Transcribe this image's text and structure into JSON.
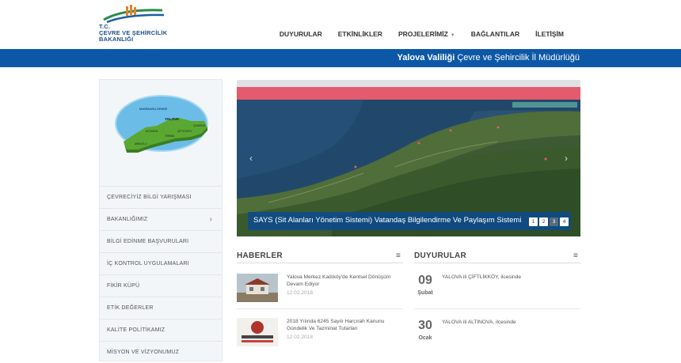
{
  "header": {
    "logo_lines": [
      "T.C.",
      "ÇEVRE VE ŞEHİRCİLİK",
      "BAKANLIĞI"
    ],
    "nav": [
      {
        "label": "DUYURULAR"
      },
      {
        "label": "ETKİNLİKLER"
      },
      {
        "label": "PROJELERİMİZ",
        "caret": "▼"
      },
      {
        "label": "BAĞLANTILAR"
      },
      {
        "label": "İLETİŞİM"
      }
    ]
  },
  "band": {
    "bold": "Yalova Valiliği",
    "text": " Çevre ve Şehircilik İl Müdürlüğü"
  },
  "sidebar": {
    "map_labels": {
      "sea": "MARMARA DENİZİ",
      "city": "YALOVA",
      "d1": "ALTINOVA",
      "d2": "ÇİFTLİKKÖY",
      "d3": "TERMAL",
      "d4": "ARMUTLU",
      "d5": "ÇINARCIK"
    },
    "menu": [
      {
        "label": "ÇEVRECİYİZ BİLGİ YARIŞMASI",
        "chevron": ""
      },
      {
        "label": "BAKANLIĞIMIZ",
        "chevron": "›"
      },
      {
        "label": "BİLGİ EDİNME BAŞVURULARI",
        "chevron": ""
      },
      {
        "label": "İÇ KONTROL UYGULAMALARI",
        "chevron": ""
      },
      {
        "label": "FİKİR KÜPÜ",
        "chevron": ""
      },
      {
        "label": "ETİK DEĞERLER",
        "chevron": ""
      },
      {
        "label": "KALİTE POLİTİKAMIZ",
        "chevron": ""
      },
      {
        "label": "MİSYON VE VİZYONUMUZ",
        "chevron": ""
      }
    ]
  },
  "slider": {
    "caption": "SAYS (Sit Alanları Yönetim Sistemi) Vatandaş Bilgilendirme Ve Paylaşım Sistemi",
    "pages": [
      "1",
      "2",
      "3",
      "4"
    ],
    "active_page": "3",
    "prev": "‹",
    "next": "›"
  },
  "news": {
    "title": "HABERLER",
    "menu_icon": "≡",
    "items": [
      {
        "title": "Yalova Merkez Kadıköy'de Kentsel Dönüşüm Devam Ediyor",
        "date": "12.02.2018"
      },
      {
        "title": "2018 Yılında 6245 Sayılı Harcırah Kanunu Gündelik Ve Tazminat Tutarları",
        "date": "12.02.2018"
      }
    ]
  },
  "announcements": {
    "title": "DUYURULAR",
    "menu_icon": "≡",
    "items": [
      {
        "day": "09",
        "month": "Şubat",
        "text": "YALOVA ili ÇİFTLİKKÖY, ilcesinde"
      },
      {
        "day": "30",
        "month": "Ocak",
        "text": "YALOVA ili ALTINOVA, ilcesinde"
      }
    ]
  },
  "colors": {
    "brand_blue": "#0d58a6",
    "nav_pink": "#e35b6c",
    "caption_bg": "#0d4a8c"
  }
}
